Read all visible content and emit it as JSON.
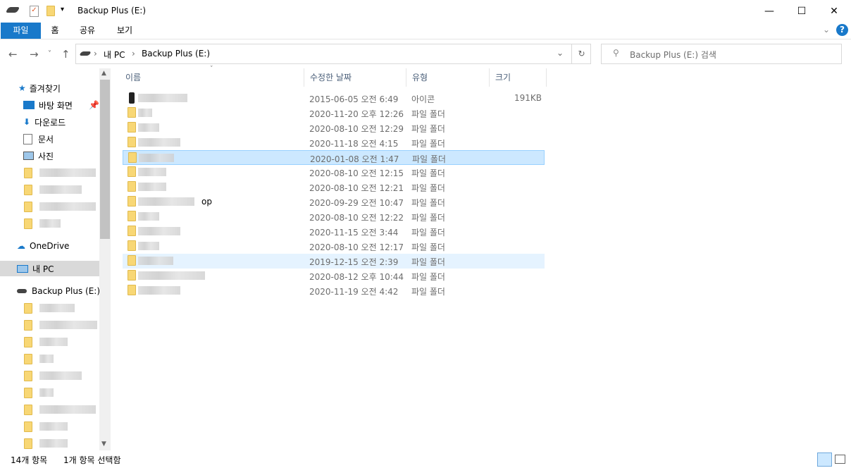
{
  "window": {
    "title": "Backup Plus (E:)"
  },
  "ribbon": {
    "tabs": [
      "파일",
      "홈",
      "공유",
      "보기"
    ]
  },
  "address": {
    "crumbs": [
      "내 PC",
      "Backup Plus (E:)"
    ]
  },
  "search": {
    "placeholder": "Backup Plus (E:) 검색"
  },
  "columns": {
    "name": "이름",
    "date": "수정한 날짜",
    "type": "유형",
    "size": "크기"
  },
  "sidebar": {
    "favorites": "즐겨찾기",
    "quick": [
      "바탕 화면",
      "다운로드",
      "문서",
      "사진"
    ],
    "onedrive": "OneDrive",
    "thispc": "내 PC",
    "drive": "Backup Plus (E:)"
  },
  "files": [
    {
      "name": "",
      "date": "2015-06-05 오전 6:49",
      "type": "아이콘",
      "size": "191KB",
      "icon": "drive-icon"
    },
    {
      "name": "",
      "date": "2020-11-20 오후 12:26",
      "type": "파일 폴더",
      "size": ""
    },
    {
      "name": "",
      "date": "2020-08-10 오전 12:29",
      "type": "파일 폴더",
      "size": ""
    },
    {
      "name": "",
      "date": "2020-11-18 오전 4:15",
      "type": "파일 폴더",
      "size": ""
    },
    {
      "name": "",
      "date": "2020-01-08 오전 1:47",
      "type": "파일 폴더",
      "size": "",
      "selected": true
    },
    {
      "name": "",
      "date": "2020-08-10 오전 12:15",
      "type": "파일 폴더",
      "size": ""
    },
    {
      "name": "",
      "date": "2020-08-10 오전 12:21",
      "type": "파일 폴더",
      "size": ""
    },
    {
      "name": "op",
      "date": "2020-09-29 오전 10:47",
      "type": "파일 폴더",
      "size": ""
    },
    {
      "name": "",
      "date": "2020-08-10 오전 12:22",
      "type": "파일 폴더",
      "size": ""
    },
    {
      "name": "",
      "date": "2020-11-15 오전 3:44",
      "type": "파일 폴더",
      "size": ""
    },
    {
      "name": "",
      "date": "2020-08-10 오전 12:17",
      "type": "파일 폴더",
      "size": ""
    },
    {
      "name": "",
      "date": "2019-12-15 오전 2:39",
      "type": "파일 폴더",
      "size": "",
      "hover": true
    },
    {
      "name": "",
      "date": "2020-08-12 오후 10:44",
      "type": "파일 폴더",
      "size": ""
    },
    {
      "name": "",
      "date": "2020-11-19 오전 4:42",
      "type": "파일 폴더",
      "size": ""
    }
  ],
  "status": {
    "count": "14개 항목",
    "selected": "1개 항목 선택함"
  }
}
